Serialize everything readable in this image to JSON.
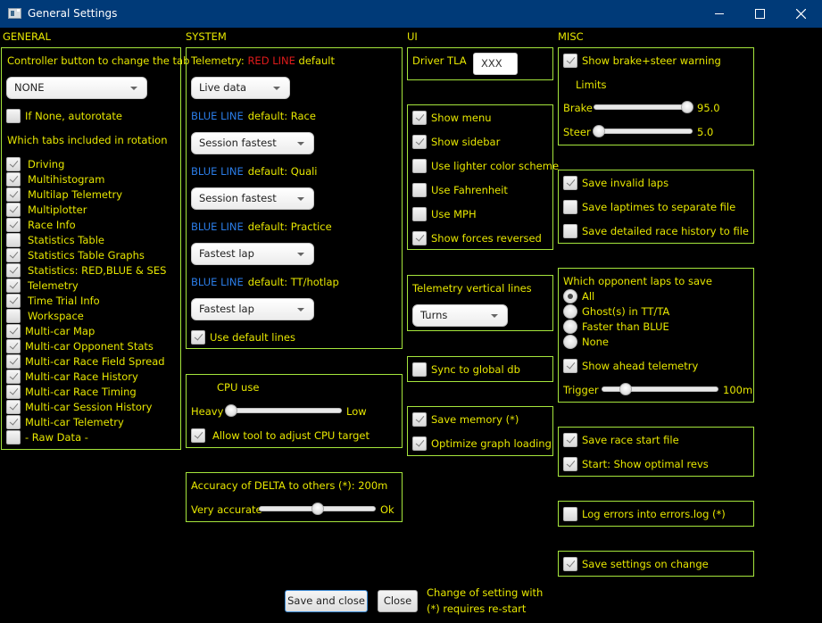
{
  "window": {
    "title": "General Settings",
    "controls": {
      "minimize": "minimize",
      "maximize": "maximize",
      "close": "close"
    }
  },
  "sections": {
    "general": "GENERAL",
    "system": "SYSTEM",
    "ui": "UI",
    "misc": "MISC"
  },
  "general": {
    "controller_label": "Controller button to change the tab",
    "controller_value": "NONE",
    "autorotate": {
      "label": "If None, autorotate",
      "checked": false
    },
    "rotation_label": "Which tabs included in rotation",
    "tabs": [
      {
        "label": "Driving",
        "checked": true
      },
      {
        "label": "Multihistogram",
        "checked": true
      },
      {
        "label": "Multilap Telemetry",
        "checked": true
      },
      {
        "label": "Multiplotter",
        "checked": true
      },
      {
        "label": "Race Info",
        "checked": true
      },
      {
        "label": "Statistics Table",
        "checked": false
      },
      {
        "label": "Statistics Table Graphs",
        "checked": true
      },
      {
        "label": "Statistics: RED,BLUE & SES",
        "checked": true
      },
      {
        "label": "Telemetry",
        "checked": true
      },
      {
        "label": "Time Trial Info",
        "checked": true
      },
      {
        "label": "Workspace",
        "checked": false
      },
      {
        "label": "Multi-car Map",
        "checked": true
      },
      {
        "label": "Multi-car Opponent Stats",
        "checked": true
      },
      {
        "label": "Multi-car Race Field Spread",
        "checked": true
      },
      {
        "label": "Multi-car Race History",
        "checked": true
      },
      {
        "label": "Multi-car Race Timing",
        "checked": true
      },
      {
        "label": "Multi-car Session History",
        "checked": true
      },
      {
        "label": "Multi-car Telemetry",
        "checked": true
      },
      {
        "label": "- Raw Data -",
        "checked": false
      }
    ]
  },
  "system": {
    "telemetry_prefix": "Telemetry:",
    "red_line": "RED LINE",
    "red_default": "default",
    "red_value": "Live data",
    "blue_line": "BLUE LINE",
    "blue_defaults": [
      {
        "label": "default: Race",
        "value": "Session fastest"
      },
      {
        "label": "default: Quali",
        "value": "Session fastest"
      },
      {
        "label": "default: Practice",
        "value": "Fastest lap"
      },
      {
        "label": "default: TT/hotlap",
        "value": "Fastest lap"
      }
    ],
    "use_default_lines": {
      "label": "Use default lines",
      "checked": true
    },
    "cpu": {
      "title": "CPU use",
      "min_label": "Heavy",
      "max_label": "Low",
      "value_fraction": 0.05,
      "allow_adjust": {
        "label": "Allow tool to adjust CPU target",
        "checked": true
      }
    },
    "delta": {
      "title": "Accuracy of DELTA to others (*): 200m",
      "min_label": "Very accurate",
      "max_label": "Ok",
      "value_fraction": 0.5
    }
  },
  "ui": {
    "driver_tla_label": "Driver TLA",
    "driver_tla_value": "XXX",
    "options": [
      {
        "label": "Show menu",
        "checked": true
      },
      {
        "label": "Show sidebar",
        "checked": true
      },
      {
        "label": "Use lighter color scheme",
        "checked": false
      },
      {
        "label": "Use Fahrenheit",
        "checked": false
      },
      {
        "label": "Use MPH",
        "checked": false
      },
      {
        "label": "Show forces reversed",
        "checked": true
      }
    ],
    "vertical_lines_label": "Telemetry vertical lines",
    "vertical_lines_value": "Turns",
    "sync_global": {
      "label": "Sync to global db",
      "checked": false
    },
    "save_memory": {
      "label": "Save memory (*)",
      "checked": true
    },
    "optimize_graph": {
      "label": "Optimize graph loading",
      "checked": true
    }
  },
  "misc": {
    "brake_steer_warning": {
      "label": "Show brake+steer warning",
      "checked": true
    },
    "limits_label": "Limits",
    "brake": {
      "label": "Brake",
      "value": "95.0",
      "fraction": 0.95
    },
    "steer": {
      "label": "Steer",
      "value": "5.0",
      "fraction": 0.05
    },
    "save_options": [
      {
        "label": "Save invalid laps",
        "checked": true
      },
      {
        "label": "Save laptimes to separate file",
        "checked": false
      },
      {
        "label": "Save detailed race history to file",
        "checked": false
      }
    ],
    "opponent_laps_label": "Which opponent laps to save",
    "opponent_laps": [
      {
        "label": "All",
        "selected": true
      },
      {
        "label": "Ghost(s) in TT/TA",
        "selected": false
      },
      {
        "label": "Faster than BLUE",
        "selected": false
      },
      {
        "label": "None",
        "selected": false
      }
    ],
    "ahead_telemetry": {
      "label": "Show ahead telemetry",
      "checked": true
    },
    "trigger": {
      "label": "Trigger",
      "value": "100m",
      "fraction": 0.2
    },
    "race_start_file": {
      "label": "Save race start file",
      "checked": true
    },
    "optimal_revs": {
      "label": "Start: Show optimal revs",
      "checked": true
    },
    "log_errors": {
      "label": "Log errors into errors.log (*)",
      "checked": false
    },
    "save_on_change": {
      "label": "Save settings on change",
      "checked": true
    }
  },
  "footer": {
    "save_close": "Save and close",
    "close": "Close",
    "note_line1": "Change of setting with",
    "note_line2": "(*) requires re-start"
  }
}
